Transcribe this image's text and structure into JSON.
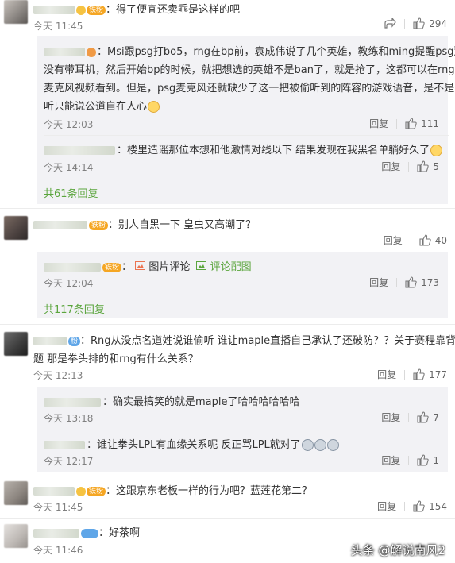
{
  "comments": [
    {
      "text": "：得了便宜还卖乖是这样的吧",
      "time": "今天 11:45",
      "likes": "294",
      "badge": "铁粉",
      "replies": [
        {
          "text": "：Msi跟psg打bo5，rng在bp前，袁成伟说了几个英雄，教练和ming提醒psg那边",
          "line2": "没有带耳机，然后开始bp的时候，就把想选的英雄不是ban了，就是抢了，这都可以在rng发的",
          "line3": "麦克风视频看到。但是，psg麦克风还就缺少了这一把被偷听到的阵容的游戏语音，是不是偷",
          "line4": "听只能说公道自在人心",
          "time": "今天 12:03",
          "likes": "111"
        },
        {
          "text": "：楼里造谣那位本想和他激情对线以下 结果发现在我黑名单躺好久了",
          "time": "今天 14:14",
          "likes": "5"
        }
      ],
      "more": "共61条回复"
    },
    {
      "text": "：别人自黑一下 皇虫又高潮了？",
      "badge": "铁粉",
      "time": "",
      "likes": "40",
      "replies": [
        {
          "text": "：",
          "pic": "图片评论",
          "pic2": "评论配图",
          "badge": "铁粉",
          "time": "今天 12:04",
          "likes": "173"
        }
      ],
      "more": "共117条回复"
    },
    {
      "text": "：Rng从没点名道姓说谁偷听 谁让maple直播自己承认了还破防？？关于赛程靠背的问",
      "line2": "题 那是拳头排的和rng有什么关系？",
      "badge": "铁粉",
      "time": "今天 12:13",
      "likes": "177",
      "replies": [
        {
          "text": "：确实最搞笑的就是maple了哈哈哈哈哈哈",
          "time": "今天 13:18",
          "likes": "7"
        },
        {
          "text": "：谁让拳头LPL有血缘关系呢 反正骂LPL就对了",
          "time": "今天 12:17",
          "likes": "1"
        }
      ]
    },
    {
      "text": "：这跟京东老板一样的行为吧？蓝莲花第二？",
      "badge": "铁粉",
      "time": "今天 11:45",
      "likes": "154"
    },
    {
      "text": "：好茶啊",
      "time": "今天 11:46",
      "likes": ""
    }
  ],
  "labels": {
    "reply": "回复"
  },
  "watermark": "头条 @解说南风2"
}
